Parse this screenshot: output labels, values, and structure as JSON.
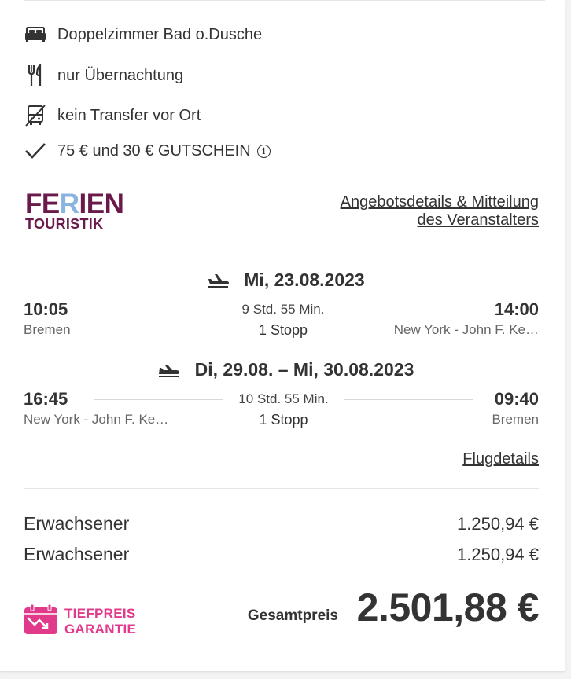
{
  "features": {
    "room": "Doppelzimmer Bad o.Dusche",
    "board": "nur Übernachtung",
    "transfer": "kein Transfer vor Ort",
    "voucher": "75 € und 30 € GUTSCHEIN",
    "info_symbol": "i"
  },
  "operator": {
    "logo_line1_a": "FE",
    "logo_line1_b": "R",
    "logo_line1_c": "IEN",
    "logo_line2": "TOURISTIK",
    "details_link_line1": "Angebotsdetails & Mitteilung",
    "details_link_line2": "des Veranstalters"
  },
  "outbound": {
    "date": "Mi, 23.08.2023",
    "dep_time": "10:05",
    "dep_place": "Bremen",
    "duration": "9 Std. 55 Min.",
    "stops": "1 Stopp",
    "arr_time": "14:00",
    "arr_place": "New York - John F. Ke…"
  },
  "inbound": {
    "date": "Di, 29.08. – Mi, 30.08.2023",
    "dep_time": "16:45",
    "dep_place": "New York - John F. Ke…",
    "duration": "10 Std. 55 Min.",
    "stops": "1 Stopp",
    "arr_time": "09:40",
    "arr_place": "Bremen"
  },
  "flight_details_link": "Flugdetails",
  "prices": [
    {
      "label": "Erwachsener",
      "value": "1.250,94 €"
    },
    {
      "label": "Erwachsener",
      "value": "1.250,94 €"
    }
  ],
  "badge": {
    "line1": "TIEFPREIS",
    "line2": "GARANTIE"
  },
  "total": {
    "label": "Gesamtpreis",
    "value": "2.501,88 €"
  },
  "colors": {
    "brand_purple": "#6a1a4a",
    "brand_blue": "#8ab4e0",
    "badge_pink": "#e13a8a"
  },
  "icons": [
    "bed-icon",
    "cutlery-icon",
    "no-transfer-icon",
    "checkmark-icon",
    "info-icon",
    "plane-departure-icon",
    "plane-arrival-icon",
    "tiefpreis-calendar-icon"
  ]
}
